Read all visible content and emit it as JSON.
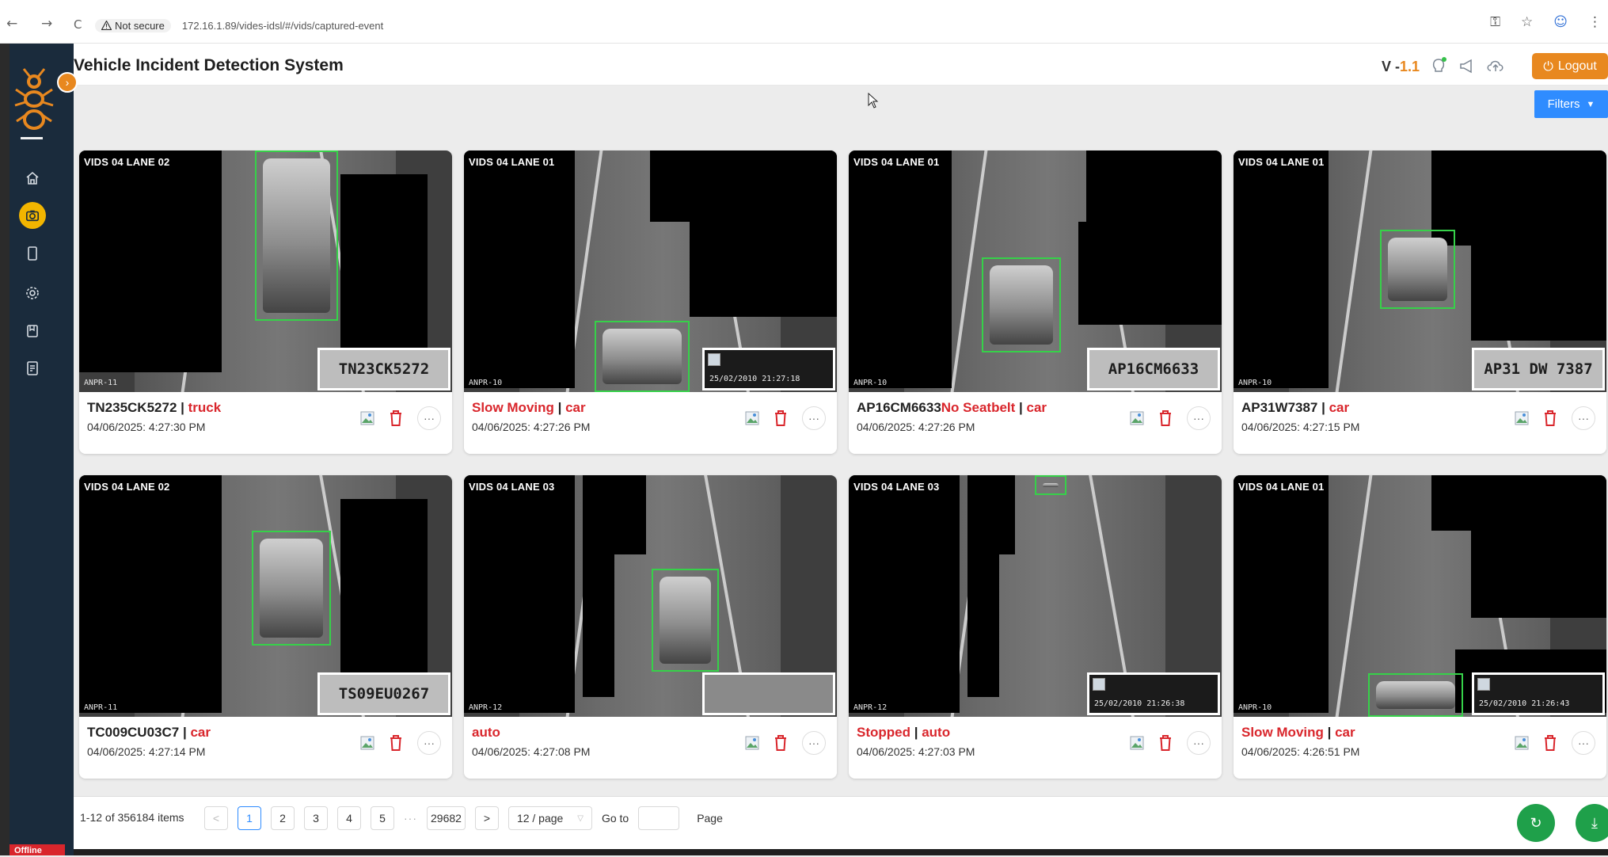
{
  "browser": {
    "back": "←",
    "forward": "→",
    "reload": "C",
    "security_label": "Not secure",
    "url": "172.16.1.89/vides-idsl/#/vids/captured-event"
  },
  "app": {
    "title": "Vehicle Incident Detection System",
    "version_prefix": "V -",
    "version_number": "1.1",
    "logout_label": "Logout",
    "filters_label": "Filters",
    "offline_label": "Offline"
  },
  "sidebar": {
    "items": [
      {
        "icon": "home-icon"
      },
      {
        "icon": "camera-icon",
        "active": true
      },
      {
        "icon": "tablet-icon"
      },
      {
        "icon": "settings-icon"
      },
      {
        "icon": "bookmark-icon"
      },
      {
        "icon": "report-icon"
      }
    ]
  },
  "events": [
    {
      "camera": "VIDS 04 LANE 02",
      "anpr": "ANPR-11",
      "plate_text": "TN23CK5272",
      "plate_broken": false,
      "id": "TN235CK5272",
      "sep": " | ",
      "incident": "",
      "vehicle": "truck",
      "id_red": false,
      "timestamp": "04/06/2025: 4:27:30 PM"
    },
    {
      "camera": "VIDS 04 LANE 01",
      "anpr": "ANPR-10",
      "plate_text": "25/02/2010 21:27:18",
      "plate_broken": true,
      "id": "",
      "sep": " | ",
      "incident": "Slow Moving",
      "vehicle": "car",
      "id_red": true,
      "timestamp": "04/06/2025: 4:27:26 PM"
    },
    {
      "camera": "VIDS 04 LANE 01",
      "anpr": "ANPR-10",
      "plate_text": "AP16CM6633",
      "plate_broken": false,
      "id": "AP16CM6633",
      "sep": " | ",
      "incident": "No Seatbelt",
      "vehicle": "car",
      "id_red": false,
      "timestamp": "04/06/2025: 4:27:26 PM"
    },
    {
      "camera": "VIDS 04 LANE 01",
      "anpr": "ANPR-10",
      "plate_text": "AP31 DW 7387",
      "plate_broken": false,
      "id": "AP31W7387",
      "sep": " | ",
      "incident": "",
      "vehicle": "car",
      "id_red": false,
      "timestamp": "04/06/2025: 4:27:15 PM"
    },
    {
      "camera": "VIDS 04 LANE 02",
      "anpr": "ANPR-11",
      "plate_text": "TS09EU0267",
      "plate_broken": false,
      "id": "TC009CU03C7",
      "sep": " | ",
      "incident": "",
      "vehicle": "car",
      "id_red": false,
      "timestamp": "04/06/2025: 4:27:14 PM"
    },
    {
      "camera": "VIDS 04 LANE 03",
      "anpr": "ANPR-12",
      "plate_text": "",
      "plate_broken": false,
      "id": "",
      "sep": "",
      "incident": "",
      "vehicle": "auto",
      "id_red": false,
      "timestamp": "04/06/2025: 4:27:08 PM"
    },
    {
      "camera": "VIDS 04 LANE 03",
      "anpr": "ANPR-12",
      "plate_text": "25/02/2010 21:26:38",
      "plate_broken": true,
      "id": "",
      "sep": " | ",
      "incident": "Stopped",
      "vehicle": "auto",
      "id_red": true,
      "timestamp": "04/06/2025: 4:27:03 PM"
    },
    {
      "camera": "VIDS 04 LANE 01",
      "anpr": "ANPR-10",
      "plate_text": "25/02/2010 21:26:43",
      "plate_broken": true,
      "id": "",
      "sep": " | ",
      "incident": "Slow Moving",
      "vehicle": "car",
      "id_red": true,
      "timestamp": "04/06/2025: 4:26:51 PM"
    }
  ],
  "pagination": {
    "range_text": "1-12 of 356184 items",
    "prev": "<",
    "pages": [
      "1",
      "2",
      "3",
      "4",
      "5"
    ],
    "ellipsis": "···",
    "last_page": "29682",
    "next": ">",
    "page_size": "12 / page",
    "goto_label": "Go to",
    "page_label": "Page",
    "current_page": "1"
  },
  "colors": {
    "accent": "#e8881f",
    "danger": "#d9262c",
    "primary": "#2f8cff",
    "success": "#1fa04a",
    "sidebar": "#1a2b3c"
  }
}
